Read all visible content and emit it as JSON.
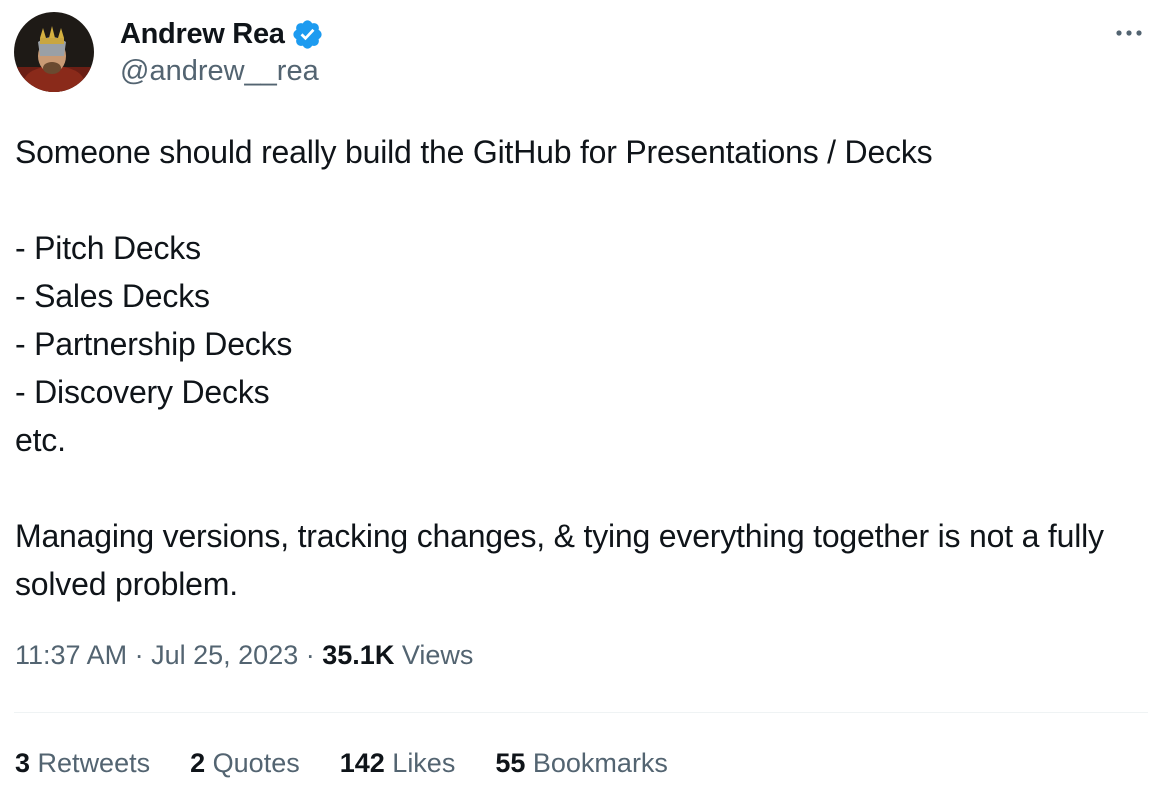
{
  "author": {
    "display_name": "Andrew Rea",
    "handle": "@andrew__rea",
    "verified": true,
    "accent_color": "#1d9bf0"
  },
  "tweet": {
    "text": "Someone should really build the GitHub for Presentations / Decks\n\n- Pitch Decks\n- Sales Decks\n- Partnership Decks\n- Discovery Decks\netc.\n\nManaging versions, tracking changes, & tying everything together is not a fully solved problem."
  },
  "meta": {
    "time": "11:37 AM",
    "separator": "·",
    "date": "Jul 25, 2023",
    "views_count": "35.1K",
    "views_label": "Views"
  },
  "stats": [
    {
      "count": "3",
      "label": "Retweets"
    },
    {
      "count": "2",
      "label": "Quotes"
    },
    {
      "count": "142",
      "label": "Likes"
    },
    {
      "count": "55",
      "label": "Bookmarks"
    }
  ],
  "icons": {
    "verified": "verified-badge-icon",
    "more": "more-horizontal-icon"
  },
  "colors": {
    "text_primary": "#0f1419",
    "text_secondary": "#536471",
    "divider": "#eff3f4"
  }
}
